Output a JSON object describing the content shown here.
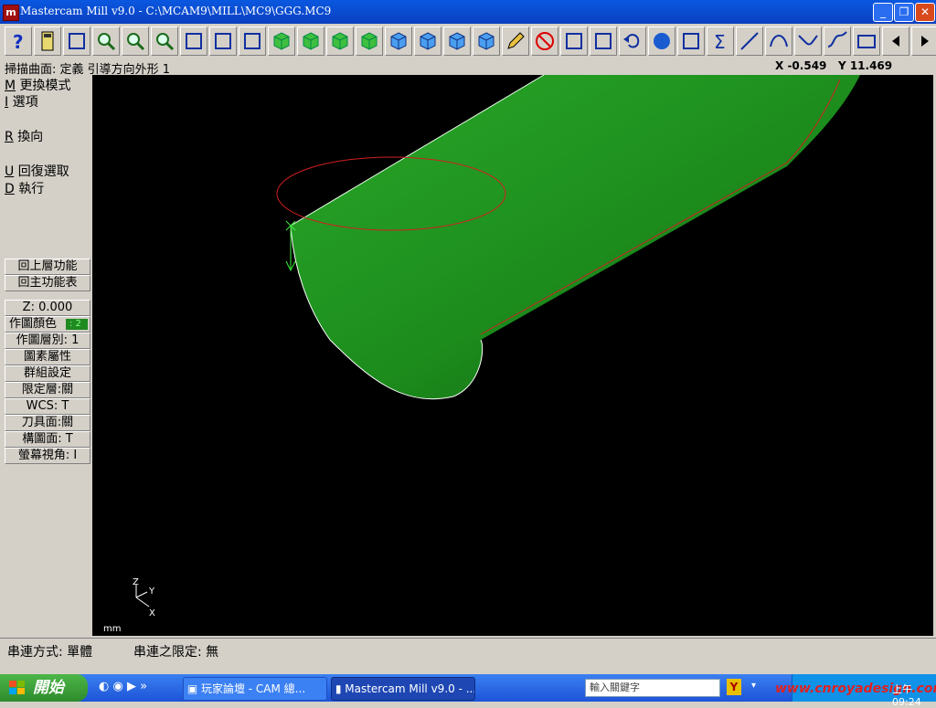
{
  "window": {
    "title": "Mastercam Mill v9.0 - C:\\MCAM9\\MILL\\MC9\\GGG.MC9",
    "app_icon": "mastercam-icon",
    "controls": [
      "minimize",
      "restore",
      "close"
    ]
  },
  "toolbar": {
    "icons": [
      "help-icon",
      "calculator-icon",
      "pointer-question-icon",
      "zoom-window-icon",
      "zoom-out-icon",
      "zoom-8-icon",
      "pan-icon",
      "select-icon",
      "rotate-icon",
      "view-top-icon",
      "view-front-icon",
      "view-side-icon",
      "view-iso-icon",
      "cube-1-icon",
      "cube-2-icon",
      "cube-3-icon",
      "cube-4-icon",
      "pencil-icon",
      "delete-icon",
      "transform-1-icon",
      "transform-2-icon",
      "undo-icon",
      "sphere-icon",
      "group-icon",
      "sigma-icon",
      "line-icon",
      "arc-icon",
      "fillet-icon",
      "spline-icon",
      "rectangle-icon",
      "left-arrow-icon",
      "right-arrow-icon"
    ]
  },
  "status": {
    "prompt": "掃描曲面: 定義 引導方向外形 1",
    "x_label": "X",
    "x_value": "-0.549",
    "y_label": "Y",
    "y_value": "11.469"
  },
  "menu": {
    "items": [
      {
        "key": "M",
        "label": "更換模式"
      },
      {
        "key": "I",
        "label": "選項"
      },
      {
        "key": "R",
        "label": "換向"
      },
      {
        "key": "U",
        "label": "回復選取"
      },
      {
        "key": "D",
        "label": "執行"
      }
    ],
    "nav_buttons": [
      "回上層功能",
      "回主功能表"
    ],
    "settings": {
      "z": "Z:  0.000",
      "color": "作圖顏色",
      "color_value": ": 2",
      "level": "作圖層別: 1",
      "attributes": "圖素屬性",
      "group": "群組設定",
      "mask": "限定層:關",
      "wcs": "WCS:  T",
      "tplane": "刀具面:關",
      "cplane": "構圖面: T",
      "gview": "螢幕視角: I"
    }
  },
  "viewport": {
    "background": "#000000",
    "surface_color": "#1f8f1f",
    "curve_color": "#d02020",
    "axis": {
      "z": "Z",
      "y": "Y",
      "x": "X"
    },
    "units": "mm"
  },
  "chaining": {
    "mode": "串連方式: 單體",
    "limit": "串連之限定: 無"
  },
  "taskbar": {
    "start": "開始",
    "tasks": [
      "玩家論壇 - CAM 總...",
      "Mastercam Mill v9.0 - ..."
    ],
    "search_placeholder": "輸入關鍵字",
    "watermark": "www.cnroyadesign.com",
    "clock": "上午 09:24"
  }
}
